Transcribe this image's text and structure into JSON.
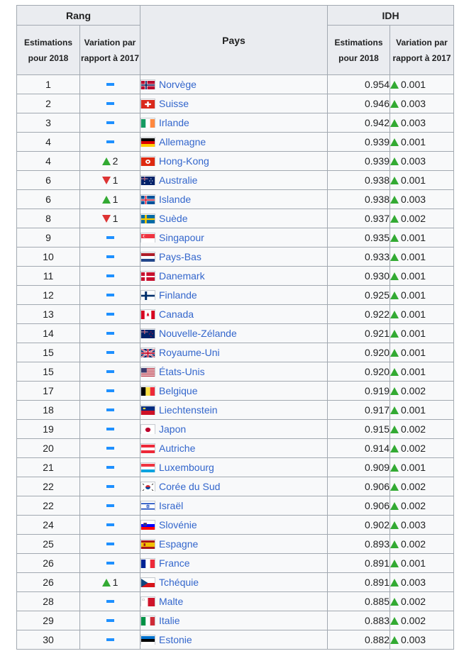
{
  "header": {
    "rang": "Rang",
    "pays": "Pays",
    "idh": "IDH",
    "est": "Estimations pour 2018",
    "var": "Variation par rapport à 2017"
  },
  "colors": {
    "up": "#33aa33",
    "down": "#dd3333",
    "same": "#1e90ff",
    "link": "#3366cc"
  },
  "rows": [
    {
      "rank": "1",
      "rchg": "same",
      "rval": "",
      "country": "Norvège",
      "flag": "no",
      "idh": "0.954",
      "ichg": "0.001"
    },
    {
      "rank": "2",
      "rchg": "same",
      "rval": "",
      "country": "Suisse",
      "flag": "ch",
      "idh": "0.946",
      "ichg": "0.003"
    },
    {
      "rank": "3",
      "rchg": "same",
      "rval": "",
      "country": "Irlande",
      "flag": "ie",
      "idh": "0.942",
      "ichg": "0.003"
    },
    {
      "rank": "4",
      "rchg": "same",
      "rval": "",
      "country": "Allemagne",
      "flag": "de",
      "idh": "0.939",
      "ichg": "0.001"
    },
    {
      "rank": "4",
      "rchg": "up",
      "rval": "2",
      "country": "Hong-Kong",
      "flag": "hk",
      "idh": "0.939",
      "ichg": "0.003"
    },
    {
      "rank": "6",
      "rchg": "down",
      "rval": "1",
      "country": "Australie",
      "flag": "au",
      "idh": "0.938",
      "ichg": "0.001"
    },
    {
      "rank": "6",
      "rchg": "up",
      "rval": "1",
      "country": "Islande",
      "flag": "is",
      "idh": "0.938",
      "ichg": "0.003"
    },
    {
      "rank": "8",
      "rchg": "down",
      "rval": "1",
      "country": "Suède",
      "flag": "se",
      "idh": "0.937",
      "ichg": "0.002"
    },
    {
      "rank": "9",
      "rchg": "same",
      "rval": "",
      "country": "Singapour",
      "flag": "sg",
      "idh": "0.935",
      "ichg": "0.001"
    },
    {
      "rank": "10",
      "rchg": "same",
      "rval": "",
      "country": "Pays-Bas",
      "flag": "nl",
      "idh": "0.933",
      "ichg": "0.001"
    },
    {
      "rank": "11",
      "rchg": "same",
      "rval": "",
      "country": "Danemark",
      "flag": "dk",
      "idh": "0.930",
      "ichg": "0.001"
    },
    {
      "rank": "12",
      "rchg": "same",
      "rval": "",
      "country": "Finlande",
      "flag": "fi",
      "idh": "0.925",
      "ichg": "0.001"
    },
    {
      "rank": "13",
      "rchg": "same",
      "rval": "",
      "country": "Canada",
      "flag": "ca",
      "idh": "0.922",
      "ichg": "0.001"
    },
    {
      "rank": "14",
      "rchg": "same",
      "rval": "",
      "country": "Nouvelle-Zélande",
      "flag": "nz",
      "idh": "0.921",
      "ichg": "0.001"
    },
    {
      "rank": "15",
      "rchg": "same",
      "rval": "",
      "country": "Royaume-Uni",
      "flag": "gb",
      "idh": "0.920",
      "ichg": "0.001"
    },
    {
      "rank": "15",
      "rchg": "same",
      "rval": "",
      "country": "États-Unis",
      "flag": "us",
      "idh": "0.920",
      "ichg": "0.001"
    },
    {
      "rank": "17",
      "rchg": "same",
      "rval": "",
      "country": "Belgique",
      "flag": "be",
      "idh": "0.919",
      "ichg": "0.002"
    },
    {
      "rank": "18",
      "rchg": "same",
      "rval": "",
      "country": "Liechtenstein",
      "flag": "li",
      "idh": "0.917",
      "ichg": "0.001"
    },
    {
      "rank": "19",
      "rchg": "same",
      "rval": "",
      "country": "Japon",
      "flag": "jp",
      "idh": "0.915",
      "ichg": "0.002"
    },
    {
      "rank": "20",
      "rchg": "same",
      "rval": "",
      "country": "Autriche",
      "flag": "at",
      "idh": "0.914",
      "ichg": "0.002"
    },
    {
      "rank": "21",
      "rchg": "same",
      "rval": "",
      "country": "Luxembourg",
      "flag": "lu",
      "idh": "0.909",
      "ichg": "0.001"
    },
    {
      "rank": "22",
      "rchg": "same",
      "rval": "",
      "country": "Corée du Sud",
      "flag": "kr",
      "idh": "0.906",
      "ichg": "0.002"
    },
    {
      "rank": "22",
      "rchg": "same",
      "rval": "",
      "country": "Israël",
      "flag": "il",
      "idh": "0.906",
      "ichg": "0.002"
    },
    {
      "rank": "24",
      "rchg": "same",
      "rval": "",
      "country": "Slovénie",
      "flag": "si",
      "idh": "0.902",
      "ichg": "0.003"
    },
    {
      "rank": "25",
      "rchg": "same",
      "rval": "",
      "country": "Espagne",
      "flag": "es",
      "idh": "0.893",
      "ichg": "0.002"
    },
    {
      "rank": "26",
      "rchg": "same",
      "rval": "",
      "country": "France",
      "flag": "fr",
      "idh": "0.891",
      "ichg": "0.001"
    },
    {
      "rank": "26",
      "rchg": "up",
      "rval": "1",
      "country": "Tchéquie",
      "flag": "cz",
      "idh": "0.891",
      "ichg": "0.003"
    },
    {
      "rank": "28",
      "rchg": "same",
      "rval": "",
      "country": "Malte",
      "flag": "mt",
      "idh": "0.885",
      "ichg": "0.002"
    },
    {
      "rank": "29",
      "rchg": "same",
      "rval": "",
      "country": "Italie",
      "flag": "it",
      "idh": "0.883",
      "ichg": "0.002"
    },
    {
      "rank": "30",
      "rchg": "same",
      "rval": "",
      "country": "Estonie",
      "flag": "ee",
      "idh": "0.882",
      "ichg": "0.003"
    }
  ]
}
